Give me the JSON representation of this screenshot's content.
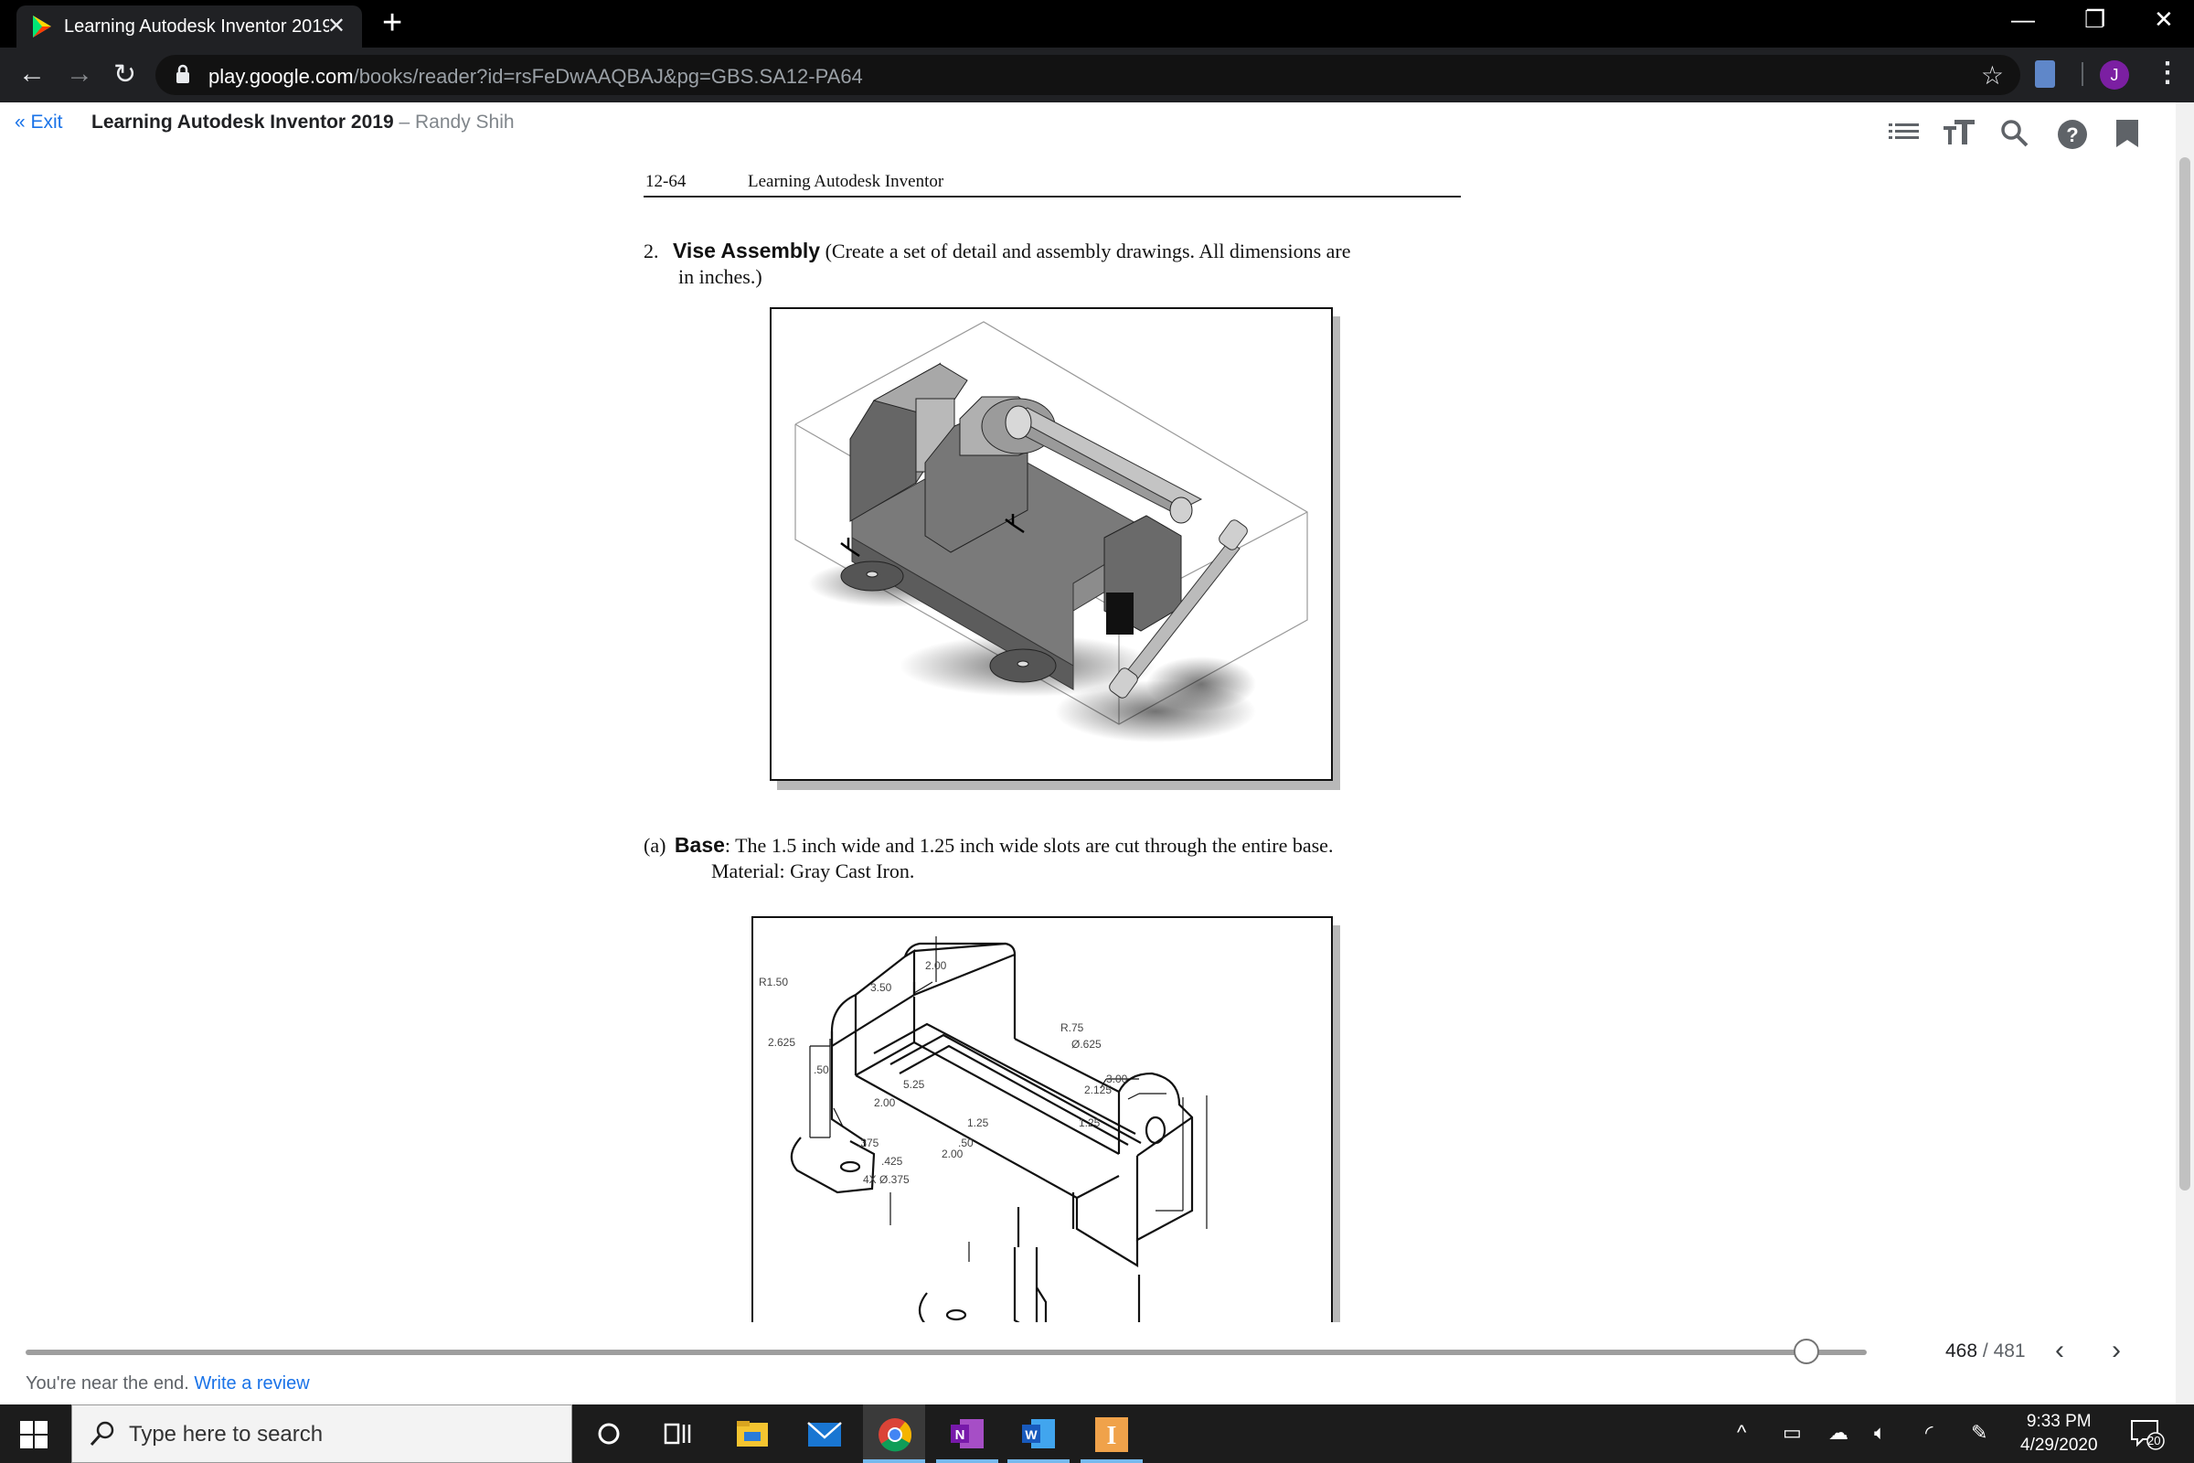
{
  "browser": {
    "tab_title": "Learning Autodesk Inventor 2019",
    "tab_close": "✕",
    "new_tab": "+",
    "url_host": "play.google.com",
    "url_path": "/books/reader?id=rsFeDwAAQBAJ&pg=GBS.SA12-PA64",
    "avatar_initial": "J"
  },
  "reader": {
    "exit_label": "« Exit",
    "book_title": "Learning Autodesk Inventor 2019",
    "author_sep": " – ",
    "author": "Randy Shih",
    "page_current": "468",
    "page_sep": " / ",
    "page_total": "481",
    "progress": 0.967,
    "near_end_text": "You're near the end.",
    "write_review": "Write a review"
  },
  "page": {
    "running_page": "12-64",
    "running_title": "Learning Autodesk Inventor",
    "item_number": "2.",
    "item_title": "Vise Assembly",
    "item_text_1": " (Create a set of detail and assembly drawings. All dimensions are",
    "item_text_2": "in inches.)",
    "sub_label": "(a)",
    "sub_title": "Base",
    "sub_text_1": ": The 1.5 inch wide and 1.25 inch wide slots are cut through the entire base.",
    "sub_text_2": "Material:  Gray Cast Iron.",
    "dims": [
      "2.00",
      "3.50",
      "R1.50",
      "2.625",
      ".50",
      "5.25",
      "2.00",
      "R.75",
      "Ø.625",
      "3.00",
      "2.125",
      "1.25",
      "1.25",
      ".375",
      ".50",
      "2.00",
      ".425",
      "4X Ø.375"
    ]
  },
  "taskbar": {
    "search_placeholder": "Type here to search",
    "time": "9:33 PM",
    "date": "4/29/2020",
    "notifications": "20"
  },
  "icons": {
    "tab": [
      "play-books-icon"
    ],
    "toolbar": [
      "back-icon",
      "forward-icon",
      "reload-icon",
      "lock-icon",
      "star-icon",
      "extension-icon",
      "menu-icon"
    ],
    "reader": [
      "contents-icon",
      "text-size-icon",
      "search-icon",
      "help-icon",
      "bookmark-icon"
    ],
    "taskbar": [
      "windows-start-icon",
      "cortana-icon",
      "task-view-icon",
      "file-explorer-icon",
      "mail-icon",
      "chrome-icon",
      "onenote-icon",
      "word-icon",
      "inventor-icon"
    ]
  }
}
